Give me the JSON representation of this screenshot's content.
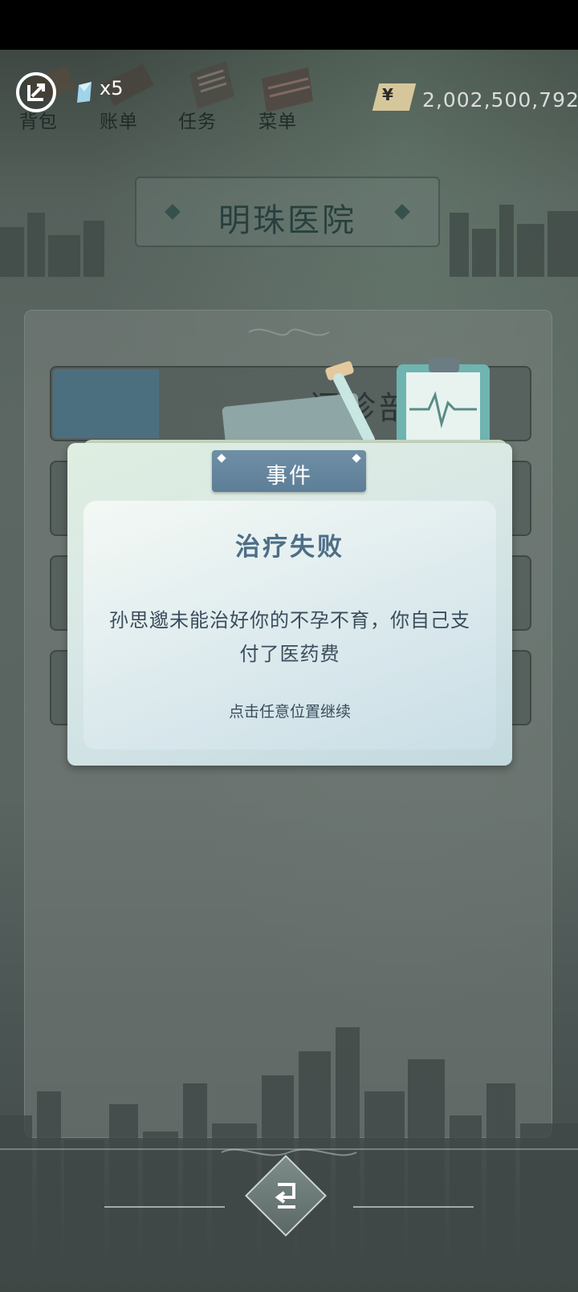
{
  "top_bar": {
    "gem_count": "x5",
    "nav": [
      {
        "label": "背包",
        "icon": "backpack-icon"
      },
      {
        "label": "账单",
        "icon": "bill-icon"
      },
      {
        "label": "任务",
        "icon": "task-icon"
      },
      {
        "label": "菜单",
        "icon": "menu-icon"
      }
    ],
    "currency_symbol": "¥",
    "money": "2,002,500,792"
  },
  "hospital": {
    "title": "明珠医院"
  },
  "departments": [
    {
      "label": "门诊部"
    }
  ],
  "event": {
    "tab": "事件",
    "title": "治疗失败",
    "body": "孙思邈未能治好你的不孕不育，你自己支付了医药费",
    "hint": "点击任意位置继续"
  },
  "colors": {
    "tab_blue": "#5d7e97",
    "title_blue": "#4d6e87",
    "card_green": "#dfeee0"
  }
}
